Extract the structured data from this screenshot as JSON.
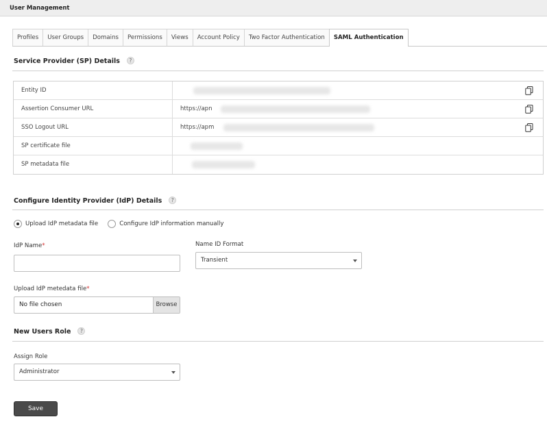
{
  "header": {
    "title": "User Management"
  },
  "tabs": [
    {
      "label": "Profiles"
    },
    {
      "label": "User Groups"
    },
    {
      "label": "Domains"
    },
    {
      "label": "Permissions"
    },
    {
      "label": "Views"
    },
    {
      "label": "Account Policy"
    },
    {
      "label": "Two Factor Authentication"
    },
    {
      "label": "SAML Authentication"
    }
  ],
  "sp_section": {
    "title": "Service Provider (SP) Details",
    "rows": [
      {
        "label": "Entity ID",
        "value": ""
      },
      {
        "label": "Assertion Consumer URL",
        "value": "https://apn"
      },
      {
        "label": "SSO Logout URL",
        "value": "https://apm"
      },
      {
        "label": "SP certificate file",
        "value": ""
      },
      {
        "label": "SP metadata file",
        "value": ""
      }
    ]
  },
  "idp_section": {
    "title": "Configure Identity Provider (IdP) Details",
    "radio_upload": "Upload IdP metadata file",
    "radio_manual": "Configure IdP information manually",
    "idp_name_label": "IdP Name",
    "idp_name_value": "",
    "name_id_label": "Name ID Format",
    "name_id_value": "Transient",
    "upload_label": "Upload IdP metedata file",
    "file_status": "No file chosen",
    "browse_label": "Browse",
    "required_mark": "*"
  },
  "role_section": {
    "title": "New Users Role",
    "assign_label": "Assign Role",
    "assign_value": "Administrator"
  },
  "help_glyph": "?",
  "save_label": "Save"
}
